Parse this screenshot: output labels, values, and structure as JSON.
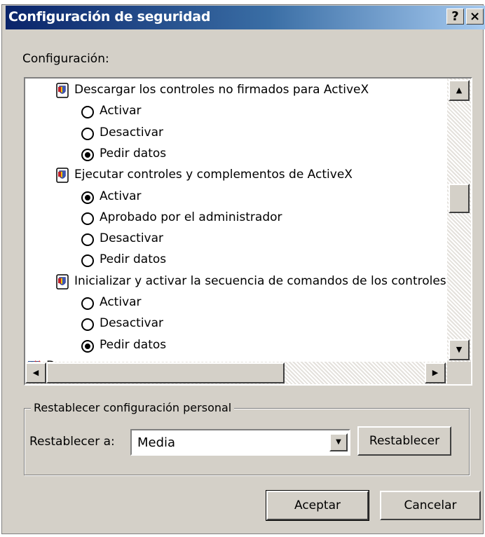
{
  "window": {
    "title": "Configuración de seguridad",
    "help_label": "?",
    "close_label": "×"
  },
  "config_label": "Configuración:",
  "settings_list": {
    "rows": [
      {
        "kind": "category",
        "label": "Descargar los controles no firmados para  ActiveX"
      },
      {
        "kind": "option",
        "label": "Activar",
        "selected": false
      },
      {
        "kind": "option",
        "label": "Desactivar",
        "selected": false
      },
      {
        "kind": "option",
        "label": "Pedir datos",
        "selected": true
      },
      {
        "kind": "category",
        "label": "Ejecutar controles y complementos de ActiveX"
      },
      {
        "kind": "option",
        "label": "Activar",
        "selected": true
      },
      {
        "kind": "option",
        "label": "Aprobado por el administrador",
        "selected": false
      },
      {
        "kind": "option",
        "label": "Desactivar",
        "selected": false
      },
      {
        "kind": "option",
        "label": "Pedir datos",
        "selected": false
      },
      {
        "kind": "category",
        "label": "Inicializar y activar la secuencia de comandos de los controles"
      },
      {
        "kind": "option",
        "label": "Activar",
        "selected": false
      },
      {
        "kind": "option",
        "label": "Desactivar",
        "selected": false
      },
      {
        "kind": "option",
        "label": "Pedir datos",
        "selected": true
      },
      {
        "kind": "section",
        "label": "Descargas"
      }
    ]
  },
  "reset_group": {
    "title": "Restablecer configuración personal",
    "reset_to_label": "Restablecer a:",
    "level_value": "Media",
    "reset_button": "Restablecer"
  },
  "footer": {
    "ok_label": "Aceptar",
    "cancel_label": "Cancelar"
  },
  "colors": {
    "titlebar_start": "#0a246a",
    "titlebar_end": "#a6caf0",
    "face": "#d4d0c8"
  }
}
